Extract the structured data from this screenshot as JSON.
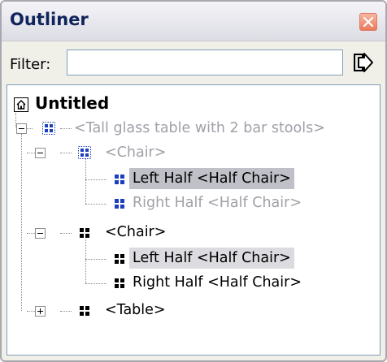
{
  "panel": {
    "title": "Outliner",
    "filter_label": "Filter:",
    "filter_value": "",
    "filter_placeholder": ""
  },
  "tree": {
    "root_label": "Untitled",
    "nodes": [
      {
        "label": "<Tall glass table with 2 bar stools>",
        "hidden": true
      },
      {
        "label": "<Chair>",
        "hidden": true
      },
      {
        "label": "Left Half <Half Chair>",
        "hidden": false,
        "selected": true
      },
      {
        "label": "Right Half <Half Chair>",
        "hidden": true
      },
      {
        "label": "<Chair>",
        "hidden": false
      },
      {
        "label": "Left Half <Half Chair>",
        "hidden": false,
        "selected": true
      },
      {
        "label": "Right Half <Half Chair>",
        "hidden": false
      },
      {
        "label": "<Table>",
        "hidden": false
      }
    ]
  },
  "colors": {
    "title_text": "#10245c",
    "hidden_text": "#a0a0a8",
    "group_icon_blue": "#1c3fbf",
    "selection_dark": "#c0c0c8",
    "selection_light": "#dcdce0"
  },
  "icons": {
    "close": "close-icon",
    "export": "export-arrow-icon",
    "root": "house-icon",
    "group": "group-icon",
    "component": "component-icon",
    "expand": "expand-icon",
    "collapse": "collapse-icon"
  }
}
